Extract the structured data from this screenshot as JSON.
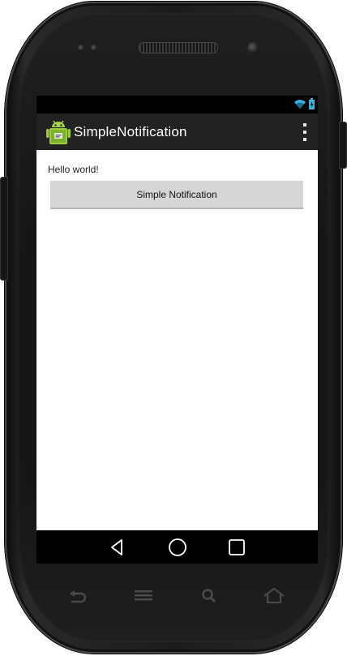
{
  "app": {
    "title": "SimpleNotification",
    "icon": "android-app-icon"
  },
  "status_bar": {
    "icons": [
      "wifi-icon",
      "battery-icon"
    ]
  },
  "action_bar": {
    "overflow_icon": "overflow-menu-icon"
  },
  "main": {
    "hello_text": "Hello world!",
    "button_label": "Simple Notification"
  },
  "nav_bar": {
    "buttons": [
      "back-icon",
      "home-icon",
      "recent-apps-icon"
    ]
  },
  "hardware_keys": [
    "hw-back-icon",
    "hw-menu-icon",
    "hw-search-icon",
    "hw-home-icon"
  ],
  "colors": {
    "action_bar": "#222222",
    "button_bg": "#d6d6d6",
    "battery_accent": "#33b5e5"
  }
}
